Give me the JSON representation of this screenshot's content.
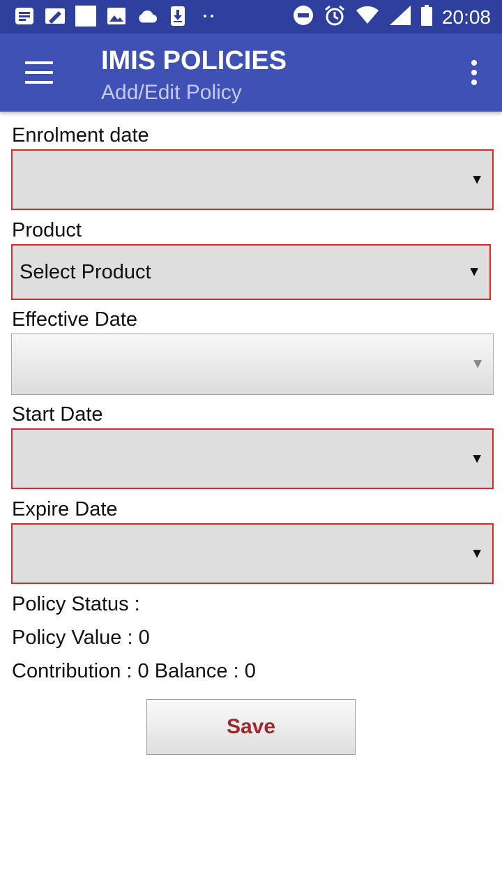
{
  "status_bar": {
    "time": "20:08",
    "left_icons": [
      "news-icon",
      "edit-icon",
      "white-square-icon",
      "image-icon",
      "cloud-icon",
      "download-icon",
      "more-dots-icon"
    ],
    "right_icons": [
      "do-not-disturb-icon",
      "alarm-icon",
      "wifi-icon",
      "signal-icon",
      "battery-icon"
    ]
  },
  "appbar": {
    "title": "IMIS POLICIES",
    "subtitle": "Add/Edit Policy",
    "color": "#3f51b5"
  },
  "form": {
    "enrolment_date": {
      "label": "Enrolment date",
      "value": ""
    },
    "product": {
      "label": "Product",
      "value": "Select Product"
    },
    "effective_date": {
      "label": "Effective Date",
      "value": ""
    },
    "start_date": {
      "label": "Start Date",
      "value": ""
    },
    "expire_date": {
      "label": "Expire Date",
      "value": ""
    },
    "policy_status": "Policy Status :",
    "policy_value": "Policy Value : 0",
    "contribution_balance": "Contribution : 0 Balance : 0",
    "save_label": "Save"
  },
  "colors": {
    "required_border": "#e0262b",
    "save_text": "#a0272a",
    "status_bar": "#2f3f9e"
  }
}
